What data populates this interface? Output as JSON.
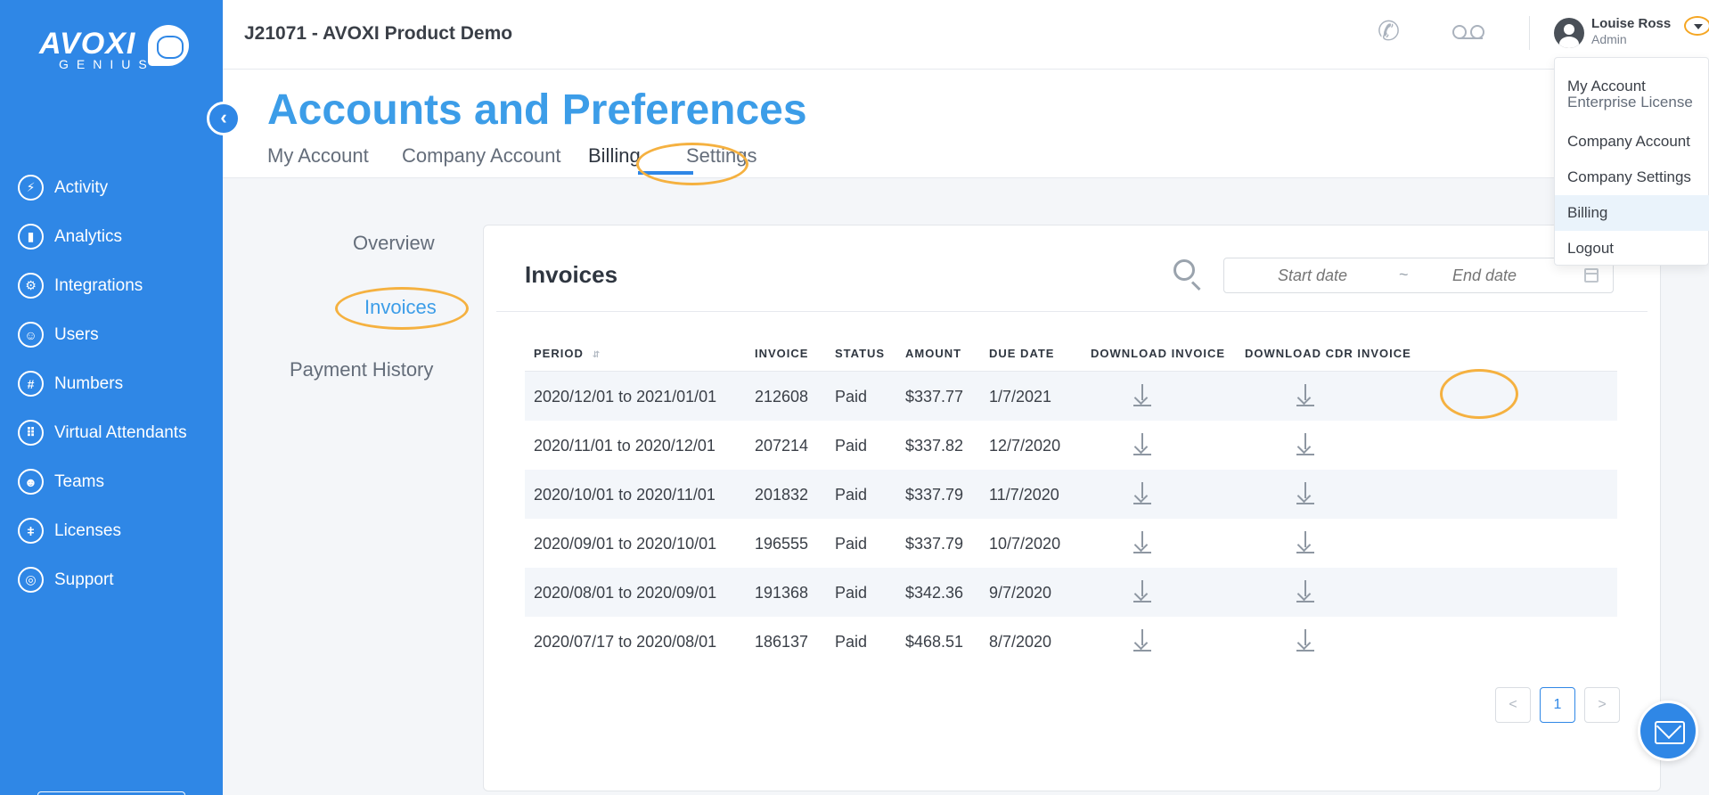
{
  "brand": {
    "name": "AVOXI",
    "sub": "GENIUS"
  },
  "sidebar": {
    "items": [
      {
        "label": "Activity",
        "icon": "lightning-icon"
      },
      {
        "label": "Analytics",
        "icon": "bar-chart-icon"
      },
      {
        "label": "Integrations",
        "icon": "gears-icon"
      },
      {
        "label": "Users",
        "icon": "users-icon"
      },
      {
        "label": "Numbers",
        "icon": "hash-icon"
      },
      {
        "label": "Virtual Attendants",
        "icon": "grid-phone-icon"
      },
      {
        "label": "Teams",
        "icon": "team-icon"
      },
      {
        "label": "Licenses",
        "icon": "key-icon"
      },
      {
        "label": "Support",
        "icon": "lifebuoy-icon"
      }
    ]
  },
  "topbar": {
    "account_title": "J21071 - AVOXI Product Demo",
    "user_name": "Louise Ross",
    "user_role": "Admin"
  },
  "header": {
    "title": "Accounts and Preferences",
    "tabs": [
      {
        "label": "My Account"
      },
      {
        "label": "Company Account"
      },
      {
        "label": "Billing",
        "active": true
      },
      {
        "label": "Settings"
      }
    ]
  },
  "billing_nav": {
    "items": [
      {
        "label": "Overview"
      },
      {
        "label": "Invoices",
        "active": true
      },
      {
        "label": "Payment History"
      }
    ]
  },
  "invoices": {
    "title": "Invoices",
    "start_placeholder": "Start date",
    "end_placeholder": "End date",
    "range_separator": "~",
    "columns": [
      "PERIOD",
      "INVOICE",
      "STATUS",
      "AMOUNT",
      "DUE DATE",
      "DOWNLOAD INVOICE",
      "DOWNLOAD CDR INVOICE"
    ],
    "rows": [
      {
        "period": "2020/12/01 to 2021/01/01",
        "invoice": "212608",
        "status": "Paid",
        "amount": "$337.77",
        "due": "1/7/2021"
      },
      {
        "period": "2020/11/01 to 2020/12/01",
        "invoice": "207214",
        "status": "Paid",
        "amount": "$337.82",
        "due": "12/7/2020"
      },
      {
        "period": "2020/10/01 to 2020/11/01",
        "invoice": "201832",
        "status": "Paid",
        "amount": "$337.79",
        "due": "11/7/2020"
      },
      {
        "period": "2020/09/01 to 2020/10/01",
        "invoice": "196555",
        "status": "Paid",
        "amount": "$337.79",
        "due": "10/7/2020"
      },
      {
        "period": "2020/08/01 to 2020/09/01",
        "invoice": "191368",
        "status": "Paid",
        "amount": "$342.36",
        "due": "9/7/2020"
      },
      {
        "period": "2020/07/17 to 2020/08/01",
        "invoice": "186137",
        "status": "Paid",
        "amount": "$468.51",
        "due": "8/7/2020"
      }
    ],
    "pagination": {
      "prev": "<",
      "current": "1",
      "next": ">"
    }
  },
  "user_menu": {
    "items": [
      {
        "label": "My Account",
        "sub": "Enterprise License"
      },
      {
        "label": "Company Account"
      },
      {
        "label": "Company Settings"
      },
      {
        "label": "Billing",
        "active": true
      },
      {
        "label": "Logout"
      }
    ]
  },
  "colors": {
    "primary": "#2f87e6",
    "title_blue": "#3c9de8",
    "highlight": "#f5b140"
  }
}
